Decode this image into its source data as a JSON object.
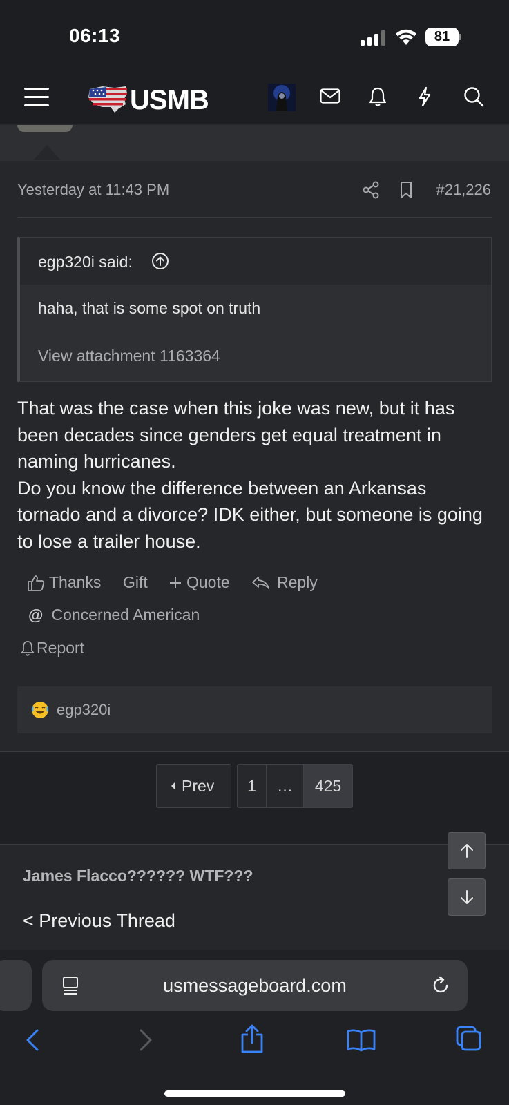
{
  "status_bar": {
    "time": "06:13",
    "battery": "81",
    "icons": [
      "signal-icon",
      "wifi-icon",
      "battery-icon"
    ]
  },
  "nav": {
    "logo_text": "USMB",
    "icons": [
      "menu-icon",
      "avatar",
      "mail-icon",
      "bell-icon",
      "lightning-icon",
      "search-icon"
    ]
  },
  "post": {
    "timestamp": "Yesterday at 11:43 PM",
    "number": "#21,226",
    "quote": {
      "author": "egp320i said:",
      "text": "haha, that is some spot on truth",
      "attachment": "View attachment 1163364"
    },
    "body": [
      "That was the case when this joke was new, but it has been decades since genders get equal treatment in naming hurricanes.",
      "Do you know the difference between an Arkansas tornado and a divorce? IDK either, but someone is going to lose a trailer house."
    ],
    "actions": {
      "thanks": "Thanks",
      "gift": "Gift",
      "quote": "Quote",
      "reply": "Reply",
      "mention": "Concerned American",
      "report": "Report"
    },
    "reaction_user": "egp320i"
  },
  "pager": {
    "prev": "Prev",
    "pages": [
      "1",
      "…",
      "425"
    ],
    "current": "425"
  },
  "thread_nav": {
    "title": "James Flacco?????? WTF???",
    "previous": "< Previous Thread"
  },
  "browser": {
    "url": "usmessageboard.com"
  },
  "colors": {
    "background": "#25272b",
    "header": "#1d1e21",
    "safari_accent": "#3a82f7"
  }
}
